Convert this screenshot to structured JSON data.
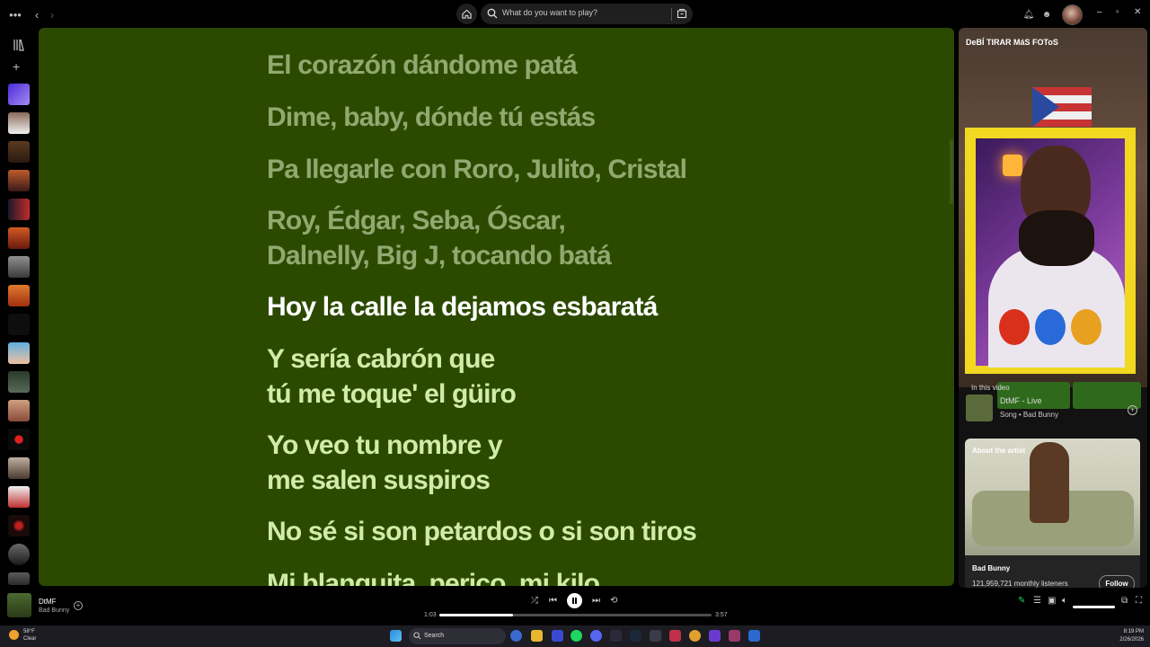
{
  "topbar": {
    "search_placeholder": "What do you want to play?",
    "icons": [
      "more-icon",
      "back-icon",
      "forward-icon",
      "home-icon",
      "search-icon",
      "browse-icon",
      "bell-icon",
      "friends-icon"
    ]
  },
  "window_controls": {
    "minimize": "–",
    "maximize": "▫",
    "close": "✕"
  },
  "lyrics": {
    "lines": [
      {
        "text": "El corazón dándome patá",
        "state": "past"
      },
      {
        "text": "Dime, baby, dónde tú estás",
        "state": "past"
      },
      {
        "text": "Pa llegarle con Roro, Julito, Cristal",
        "state": "past"
      },
      {
        "text": "Roy, Édgar, Seba, Óscar,",
        "state": "past"
      },
      {
        "text": "Dalnelly, Big J, tocando batá",
        "state": "past"
      },
      {
        "text": "Hoy la calle la dejamos esbaratá",
        "state": "current"
      },
      {
        "text": "Y sería cabrón que",
        "state": "future"
      },
      {
        "text": "tú me toque' el güiro",
        "state": "future"
      },
      {
        "text": "Yo veo tu nombre y",
        "state": "future"
      },
      {
        "text": "me salen suspiros",
        "state": "future"
      },
      {
        "text": "No sé si son petardos o si son tiros",
        "state": "future"
      },
      {
        "text": "Mi blanquita, perico, mi kilo",
        "state": "future"
      }
    ],
    "background": "#2b4a00"
  },
  "right_panel": {
    "video_title": "DeBÍ TIRAR MáS FOToS",
    "in_this_video": "In this video",
    "song_name": "DtMF - Live",
    "song_sub": "Song • Bad Bunny",
    "about_title": "About the artist",
    "artist_name": "Bad Bunny",
    "listeners": "121,959,721 monthly listeners",
    "follow": "Follow"
  },
  "player": {
    "title": "DtMF",
    "artist": "Bad Bunny",
    "elapsed": "1:03",
    "duration": "3:57",
    "progress": 0.27
  },
  "taskbar": {
    "temp": "58°F",
    "condition": "Clear",
    "search": "Search",
    "time": "8:19 PM",
    "date": "2/26/2026"
  },
  "colors": {
    "accent": "#1ed760",
    "lyrics_bg": "#2b4a00",
    "past": "#91a970",
    "current": "#ffffff",
    "future": "#d1eca8"
  }
}
